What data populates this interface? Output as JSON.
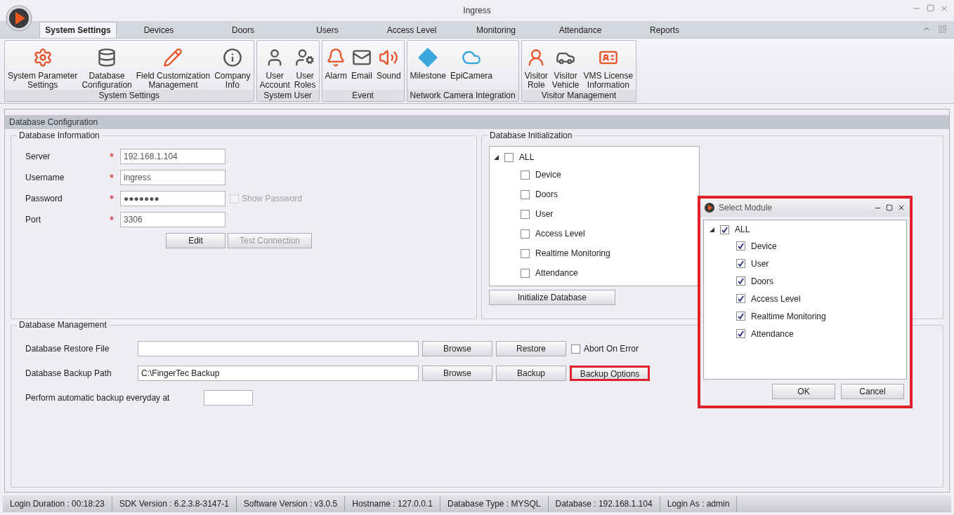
{
  "window": {
    "title": "Ingress"
  },
  "tabs": [
    {
      "label": "System Settings",
      "selected": true
    },
    {
      "label": "Devices",
      "selected": false
    },
    {
      "label": "Doors",
      "selected": false
    },
    {
      "label": "Users",
      "selected": false
    },
    {
      "label": "Access Level",
      "selected": false
    },
    {
      "label": "Monitoring",
      "selected": false
    },
    {
      "label": "Attendance",
      "selected": false
    },
    {
      "label": "Reports",
      "selected": false
    }
  ],
  "ribbon": [
    {
      "title": "System Settings",
      "items": [
        "System Parameter\nSettings",
        "Database\nConfiguration",
        "Field Customization\nManagement",
        "Company\nInfo"
      ]
    },
    {
      "title": "System User",
      "items": [
        "User\nAccount",
        "User\nRoles"
      ]
    },
    {
      "title": "Event",
      "items": [
        "Alarm",
        "Email",
        "Sound"
      ]
    },
    {
      "title": "Network Camera Integration",
      "items": [
        "Milestone",
        "EpiCamera"
      ]
    },
    {
      "title": "Visitor Management",
      "items": [
        "Visitor\nRole",
        "Visitor\nVehicle",
        "VMS License\nInformation"
      ]
    }
  ],
  "panel": {
    "title": "Database Configuration",
    "database_information": {
      "title": "Database Information",
      "fields": [
        {
          "label": "Server",
          "required": true,
          "value": "192.168.1.104"
        },
        {
          "label": "Username",
          "required": true,
          "value": "ingress"
        },
        {
          "label": "Password",
          "required": true,
          "value": "●●●●●●●"
        },
        {
          "label": "Port",
          "required": true,
          "value": "3306"
        }
      ],
      "show_password": {
        "label": "Show Password",
        "checked": false,
        "disabled": true
      },
      "buttons": [
        {
          "label": "Edit",
          "disabled": false
        },
        {
          "label": "Test Connection",
          "disabled": true
        }
      ]
    },
    "database_initialization": {
      "title": "Database Initialization",
      "tree": {
        "label": "ALL",
        "checked": false,
        "expanded": true,
        "children": [
          {
            "label": "Device",
            "checked": false
          },
          {
            "label": "Doors",
            "checked": false
          },
          {
            "label": "User",
            "checked": false
          },
          {
            "label": "Access Level",
            "checked": false
          },
          {
            "label": "Realtime Monitoring",
            "checked": false
          },
          {
            "label": "Attendance",
            "checked": false
          }
        ]
      },
      "button": "Initialize Database"
    },
    "database_management": {
      "title": "Database Management",
      "restore": {
        "label": "Database Restore File",
        "buttons": [
          {
            "label": "Browse",
            "highlighted": false
          },
          {
            "label": "Restore",
            "highlighted": false
          }
        ],
        "abort_on_error": {
          "label": "Abort On Error",
          "checked": false
        }
      },
      "backup": {
        "label": "Database Backup Path",
        "value": "C:\\FingerTec Backup",
        "buttons": [
          {
            "label": "Browse",
            "highlighted": false
          },
          {
            "label": "Backup",
            "highlighted": false
          },
          {
            "label": "Backup Options",
            "highlighted": true
          }
        ]
      },
      "auto_backup": {
        "label": "Perform automatic backup everyday at"
      }
    }
  },
  "dialog": {
    "title": "Select Module",
    "highlighted": true,
    "tree": {
      "label": "ALL",
      "checked": true,
      "expanded": true,
      "children": [
        {
          "label": "Device",
          "checked": true
        },
        {
          "label": "User",
          "checked": true
        },
        {
          "label": "Doors",
          "checked": true
        },
        {
          "label": "Access Level",
          "checked": true
        },
        {
          "label": "Realtime Monitoring",
          "checked": true
        },
        {
          "label": "Attendance",
          "checked": true
        }
      ]
    },
    "buttons": [
      "OK",
      "Cancel"
    ]
  },
  "status_bar": [
    "Login Duration : 00:18:23",
    "SDK Version : 6.2.3.8-3147-1",
    "Software Version : v3.0.5",
    "Hostname : 127.0.0.1",
    "Database Type : MYSQL",
    "Database : 192.168.1.104",
    "Login As : admin"
  ]
}
